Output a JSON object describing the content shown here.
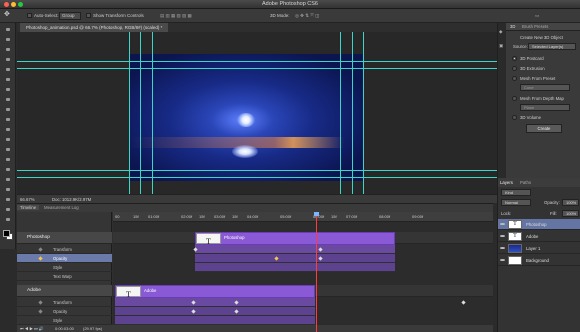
{
  "window": {
    "title": "Adobe Photoshop CS6"
  },
  "options_bar": {
    "auto_select_label": "Auto-Select:",
    "auto_select_value": "Group",
    "show_transform_label": "Show Transform Controls",
    "mode_label": "3D Mode:"
  },
  "document": {
    "tab_title": "Photoshop_animation.psd @ 66.7% (Photoshop, RGB/8#) (scaled) *",
    "zoom": "66.67%",
    "doc_size": "Doc: 1012.9K/2.97M"
  },
  "timeline": {
    "tabs": [
      "Timeline",
      "Measurement Log"
    ],
    "ruler": [
      "00",
      "01:00f",
      "02:00f",
      "03:00f",
      "04:00f",
      "05:00f",
      "06:00f",
      "07:00f",
      "08:00f",
      "09:00f"
    ],
    "ruler_extra": [
      "15f",
      "15f",
      "15f",
      "15f"
    ],
    "groups": [
      {
        "name": "Photoshop",
        "props": [
          "Transform",
          "Opacity",
          "Style",
          "Text Warp"
        ],
        "selected_prop": "Opacity"
      },
      {
        "name": "Adobe",
        "props": [
          "Transform",
          "Opacity",
          "Style",
          "Text Warp"
        ]
      }
    ],
    "clips": [
      {
        "label": "Photoshop",
        "thumb": "T"
      },
      {
        "label": "Adobe",
        "thumb": "T"
      }
    ],
    "timecode": "0:00:03:00",
    "fps": "(29.97 fps)"
  },
  "panel_3d": {
    "header": "3D",
    "tab": "Brush Presets",
    "title": "Create New 3D Object",
    "source_label": "Source:",
    "source_value": "Selected Layer(s)",
    "options": [
      "3D Postcard",
      "3D Extrusion",
      "Mesh From Preset",
      "Mesh From Depth Map",
      "3D Volume"
    ],
    "selected_option": "3D Postcard",
    "preset_value": "Cone",
    "depth_value": "Plane",
    "create_button": "Create"
  },
  "layers_panel": {
    "tabs": [
      "Layers",
      "Paths"
    ],
    "kind": "Kind",
    "blend_mode": "Normal",
    "opacity_label": "Opacity:",
    "opacity_value": "100%",
    "lock_label": "Lock:",
    "fill_label": "Fill:",
    "fill_value": "100%",
    "layers": [
      {
        "name": "Photoshop",
        "thumb": "T",
        "selected": true
      },
      {
        "name": "Adobe",
        "thumb": "T",
        "selected": false
      },
      {
        "name": "Layer 1",
        "thumb": "",
        "selected": false
      },
      {
        "name": "Background",
        "thumb": "",
        "selected": false
      }
    ]
  },
  "colors": {
    "clip": "#8a5ad6",
    "guide": "#3dd6c6",
    "playhead": "#ff3b3b",
    "selection": "#6475a4"
  }
}
